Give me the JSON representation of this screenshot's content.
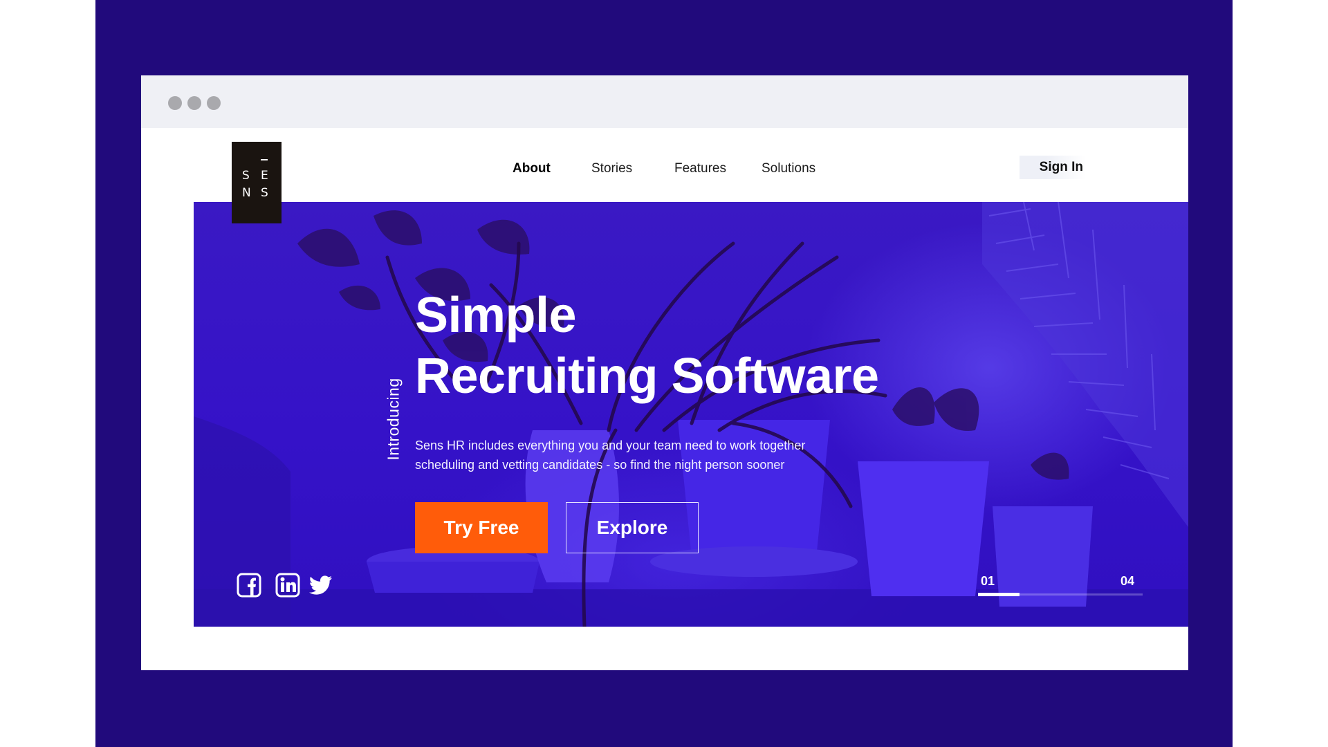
{
  "nav": {
    "items": [
      {
        "label": "About",
        "active": true
      },
      {
        "label": "Stories",
        "active": false
      },
      {
        "label": "Features",
        "active": false
      },
      {
        "label": "Solutions",
        "active": false
      }
    ],
    "signin_label": "Sign In"
  },
  "logo": {
    "letters": [
      "S",
      "E",
      "N",
      "S"
    ]
  },
  "hero": {
    "intro_label": "Introducing",
    "headline_line1": "Simple",
    "headline_line2": "Recruiting Software",
    "subtext_line1": "Sens HR includes everything you and your team need to work together",
    "subtext_line2": "scheduling and vetting candidates - so find the night person sooner",
    "primary_cta": "Try Free",
    "secondary_cta": "Explore",
    "social_icons": [
      "facebook-icon",
      "linkedin-icon",
      "twitter-icon"
    ],
    "pager": {
      "current": "01",
      "total": "04",
      "progress": 0.25
    }
  },
  "colors": {
    "backdrop": "#210a7c",
    "hero_overlay": "#3512c8",
    "primary_button": "#ff5c0a",
    "logo_bg": "#1a1410",
    "chrome_bar": "#eff0f5"
  }
}
